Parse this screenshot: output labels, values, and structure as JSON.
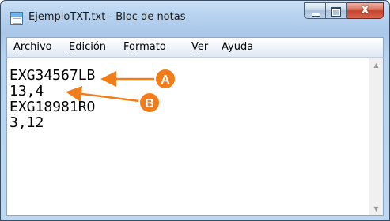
{
  "window": {
    "title": "EjemploTXT.txt - Bloc de notas",
    "icon": "notepad-icon",
    "controls": {
      "minimize": "minimize-icon",
      "maximize": "maximize-icon",
      "close_glyph": "X"
    }
  },
  "menu": {
    "items": [
      {
        "label": "Archivo",
        "accelerator": "A",
        "rest": "rchivo"
      },
      {
        "label": "Edición",
        "accelerator": "E",
        "rest": "dición"
      },
      {
        "label": "Formato",
        "accelerator": "o",
        "first": "F",
        "rest": "rmato"
      },
      {
        "label": "Ver",
        "accelerator": "V",
        "rest": "er"
      },
      {
        "label": "Ayuda",
        "accelerator": "y",
        "first": "A",
        "rest": "uda"
      }
    ]
  },
  "editor": {
    "lines": [
      "EXG34567LB",
      "13,4",
      "EXG18981RO",
      "3,12"
    ]
  },
  "annotations": {
    "accent_color": "#f07d1a",
    "callouts": [
      {
        "letter": "A"
      },
      {
        "letter": "B"
      }
    ]
  },
  "scrollbar": {
    "up_icon": "scroll-up-arrow-icon",
    "down_icon": "scroll-down-arrow-icon"
  }
}
